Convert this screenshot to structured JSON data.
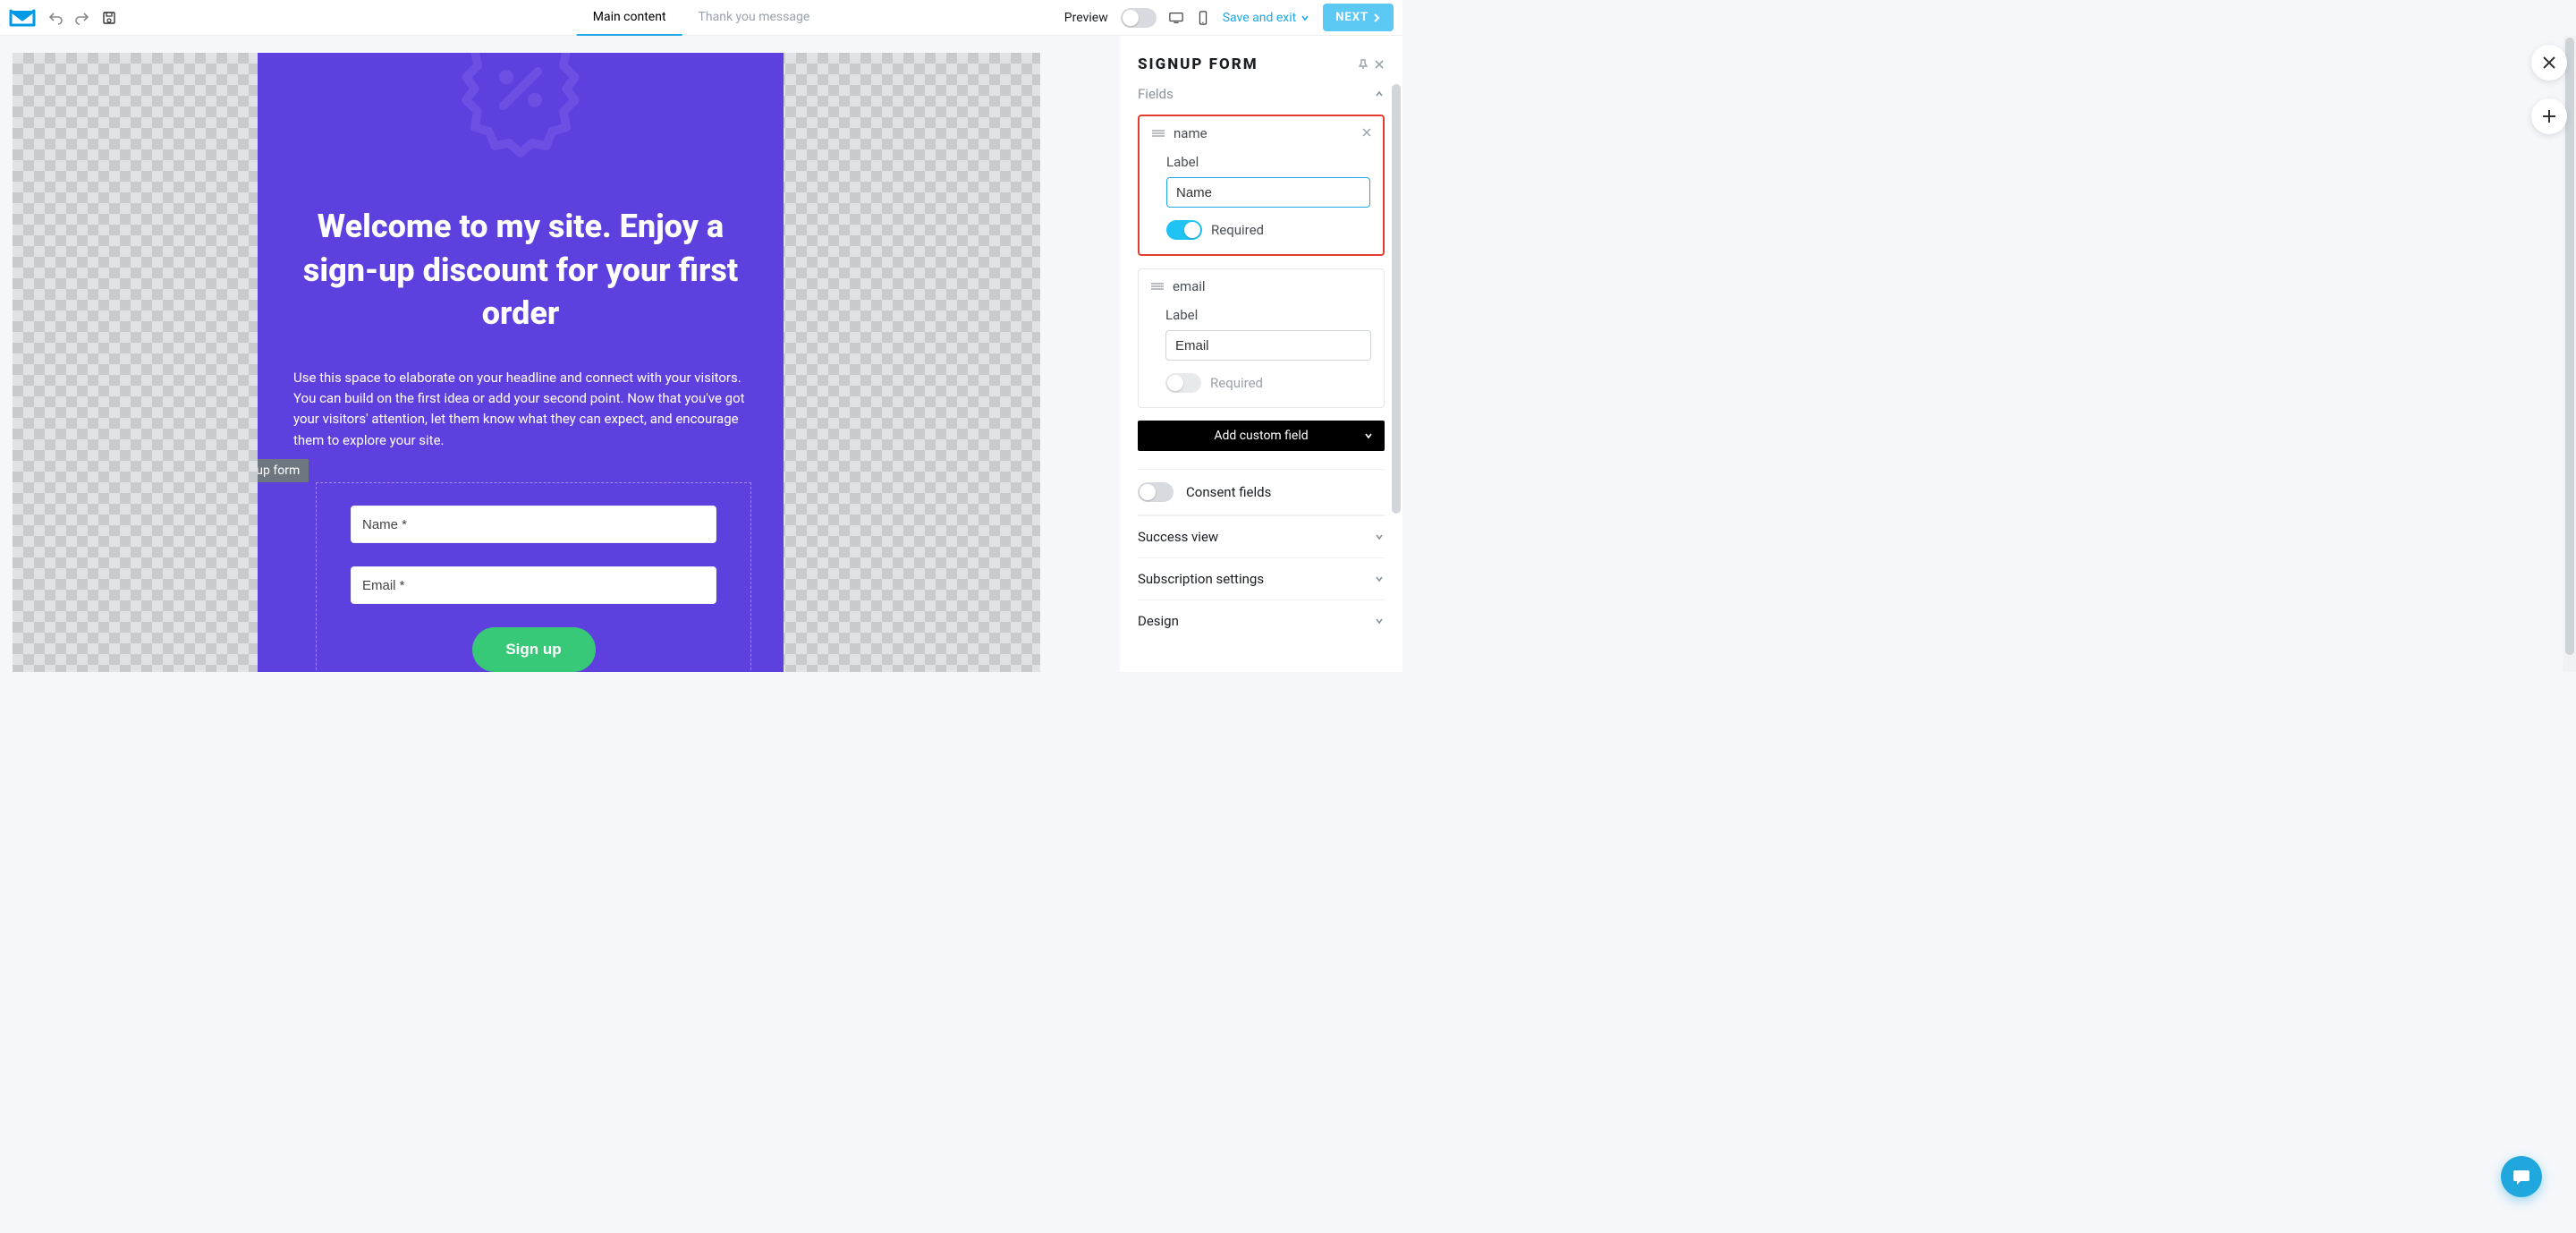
{
  "tabs": {
    "main": "Main content",
    "thank_you": "Thank you message"
  },
  "toolbar": {
    "preview": "Preview",
    "save_exit": "Save and exit",
    "next": "NEXT"
  },
  "popup": {
    "title": "Welcome to my site. Enjoy a sign-up discount for your first order",
    "desc": "Use this space to elaborate on your headline and connect with your visitors. You can build on the first idea or add your second point. Now that you've got your visitors' attention, let them know what they can expect, and encourage them to explore your site.",
    "form_tag": "Signup form",
    "name_ph": "Name *",
    "email_ph": "Email *",
    "signup": "Sign up"
  },
  "panel": {
    "title": "SIGNUP FORM",
    "fields_section": "Fields",
    "add_custom": "Add custom field",
    "consent": "Consent fields",
    "success": "Success view",
    "subscription": "Subscription settings",
    "design": "Design",
    "field_name": {
      "key": "name",
      "label_caption": "Label",
      "label_value": "Name",
      "required": "Required"
    },
    "field_email": {
      "key": "email",
      "label_caption": "Label",
      "label_value": "Email",
      "required": "Required"
    }
  }
}
